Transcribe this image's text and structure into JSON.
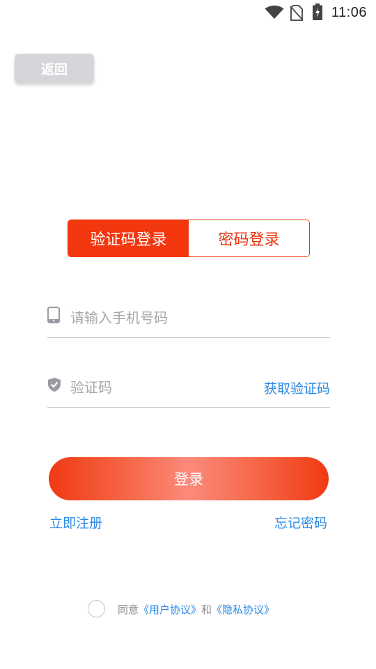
{
  "status_bar": {
    "time": "11:06",
    "icons": [
      "wifi-icon",
      "no-sim-icon",
      "battery-charging-icon"
    ]
  },
  "header": {
    "back_label": "返回"
  },
  "tabs": [
    {
      "label": "验证码登录",
      "active": true
    },
    {
      "label": "密码登录",
      "active": false
    }
  ],
  "form": {
    "phone": {
      "placeholder": "请输入手机号码",
      "icon": "phone-icon"
    },
    "code": {
      "placeholder": "验证码",
      "icon": "shield-check-icon",
      "get_code_label": "获取验证码"
    },
    "login_label": "登录"
  },
  "links": {
    "register": "立即注册",
    "forgot": "忘记密码"
  },
  "agreement": {
    "prefix": "同意",
    "user_agreement": "《用户协议》",
    "conjunction": "和",
    "privacy_agreement": "《隐私协议》",
    "checked": false
  },
  "colors": {
    "accent": "#f2360e",
    "link": "#2a8ae6",
    "placeholder": "#a7a7ab"
  }
}
